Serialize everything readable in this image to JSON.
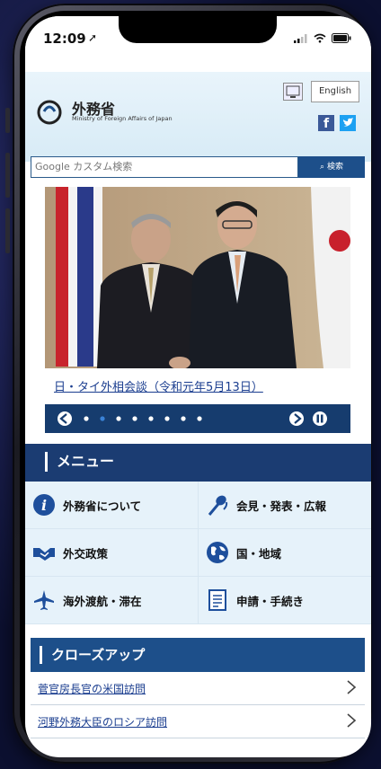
{
  "status_bar": {
    "time": "12:09"
  },
  "site": {
    "title": "外務省",
    "subtitle": "Ministry of Foreign Affairs of Japan",
    "lang_button": "English",
    "facebook_glyph": "f"
  },
  "search": {
    "placeholder": "Google カスタム検索",
    "button": "検索"
  },
  "hero": {
    "caption": "日・タイ外相会談（令和元年5月13日）"
  },
  "menu": {
    "title": "メニュー",
    "items": [
      {
        "label": "外務省について",
        "icon": "info-icon"
      },
      {
        "label": "会見・発表・広報",
        "icon": "microphone-icon"
      },
      {
        "label": "外交政策",
        "icon": "handshake-icon"
      },
      {
        "label": "国・地域",
        "icon": "globe-icon"
      },
      {
        "label": "海外渡航・滞在",
        "icon": "airplane-icon"
      },
      {
        "label": "申請・手続き",
        "icon": "document-icon"
      }
    ]
  },
  "closeup": {
    "title": "クローズアップ",
    "links": [
      {
        "label": "菅官房長官の米国訪問"
      },
      {
        "label": "河野外務大臣のロシア訪問"
      }
    ]
  },
  "colors": {
    "navy": "#1b3c72",
    "blue": "#1d4f8a",
    "link": "#1a3d8f",
    "menu_bg": "#e6f2fa"
  }
}
